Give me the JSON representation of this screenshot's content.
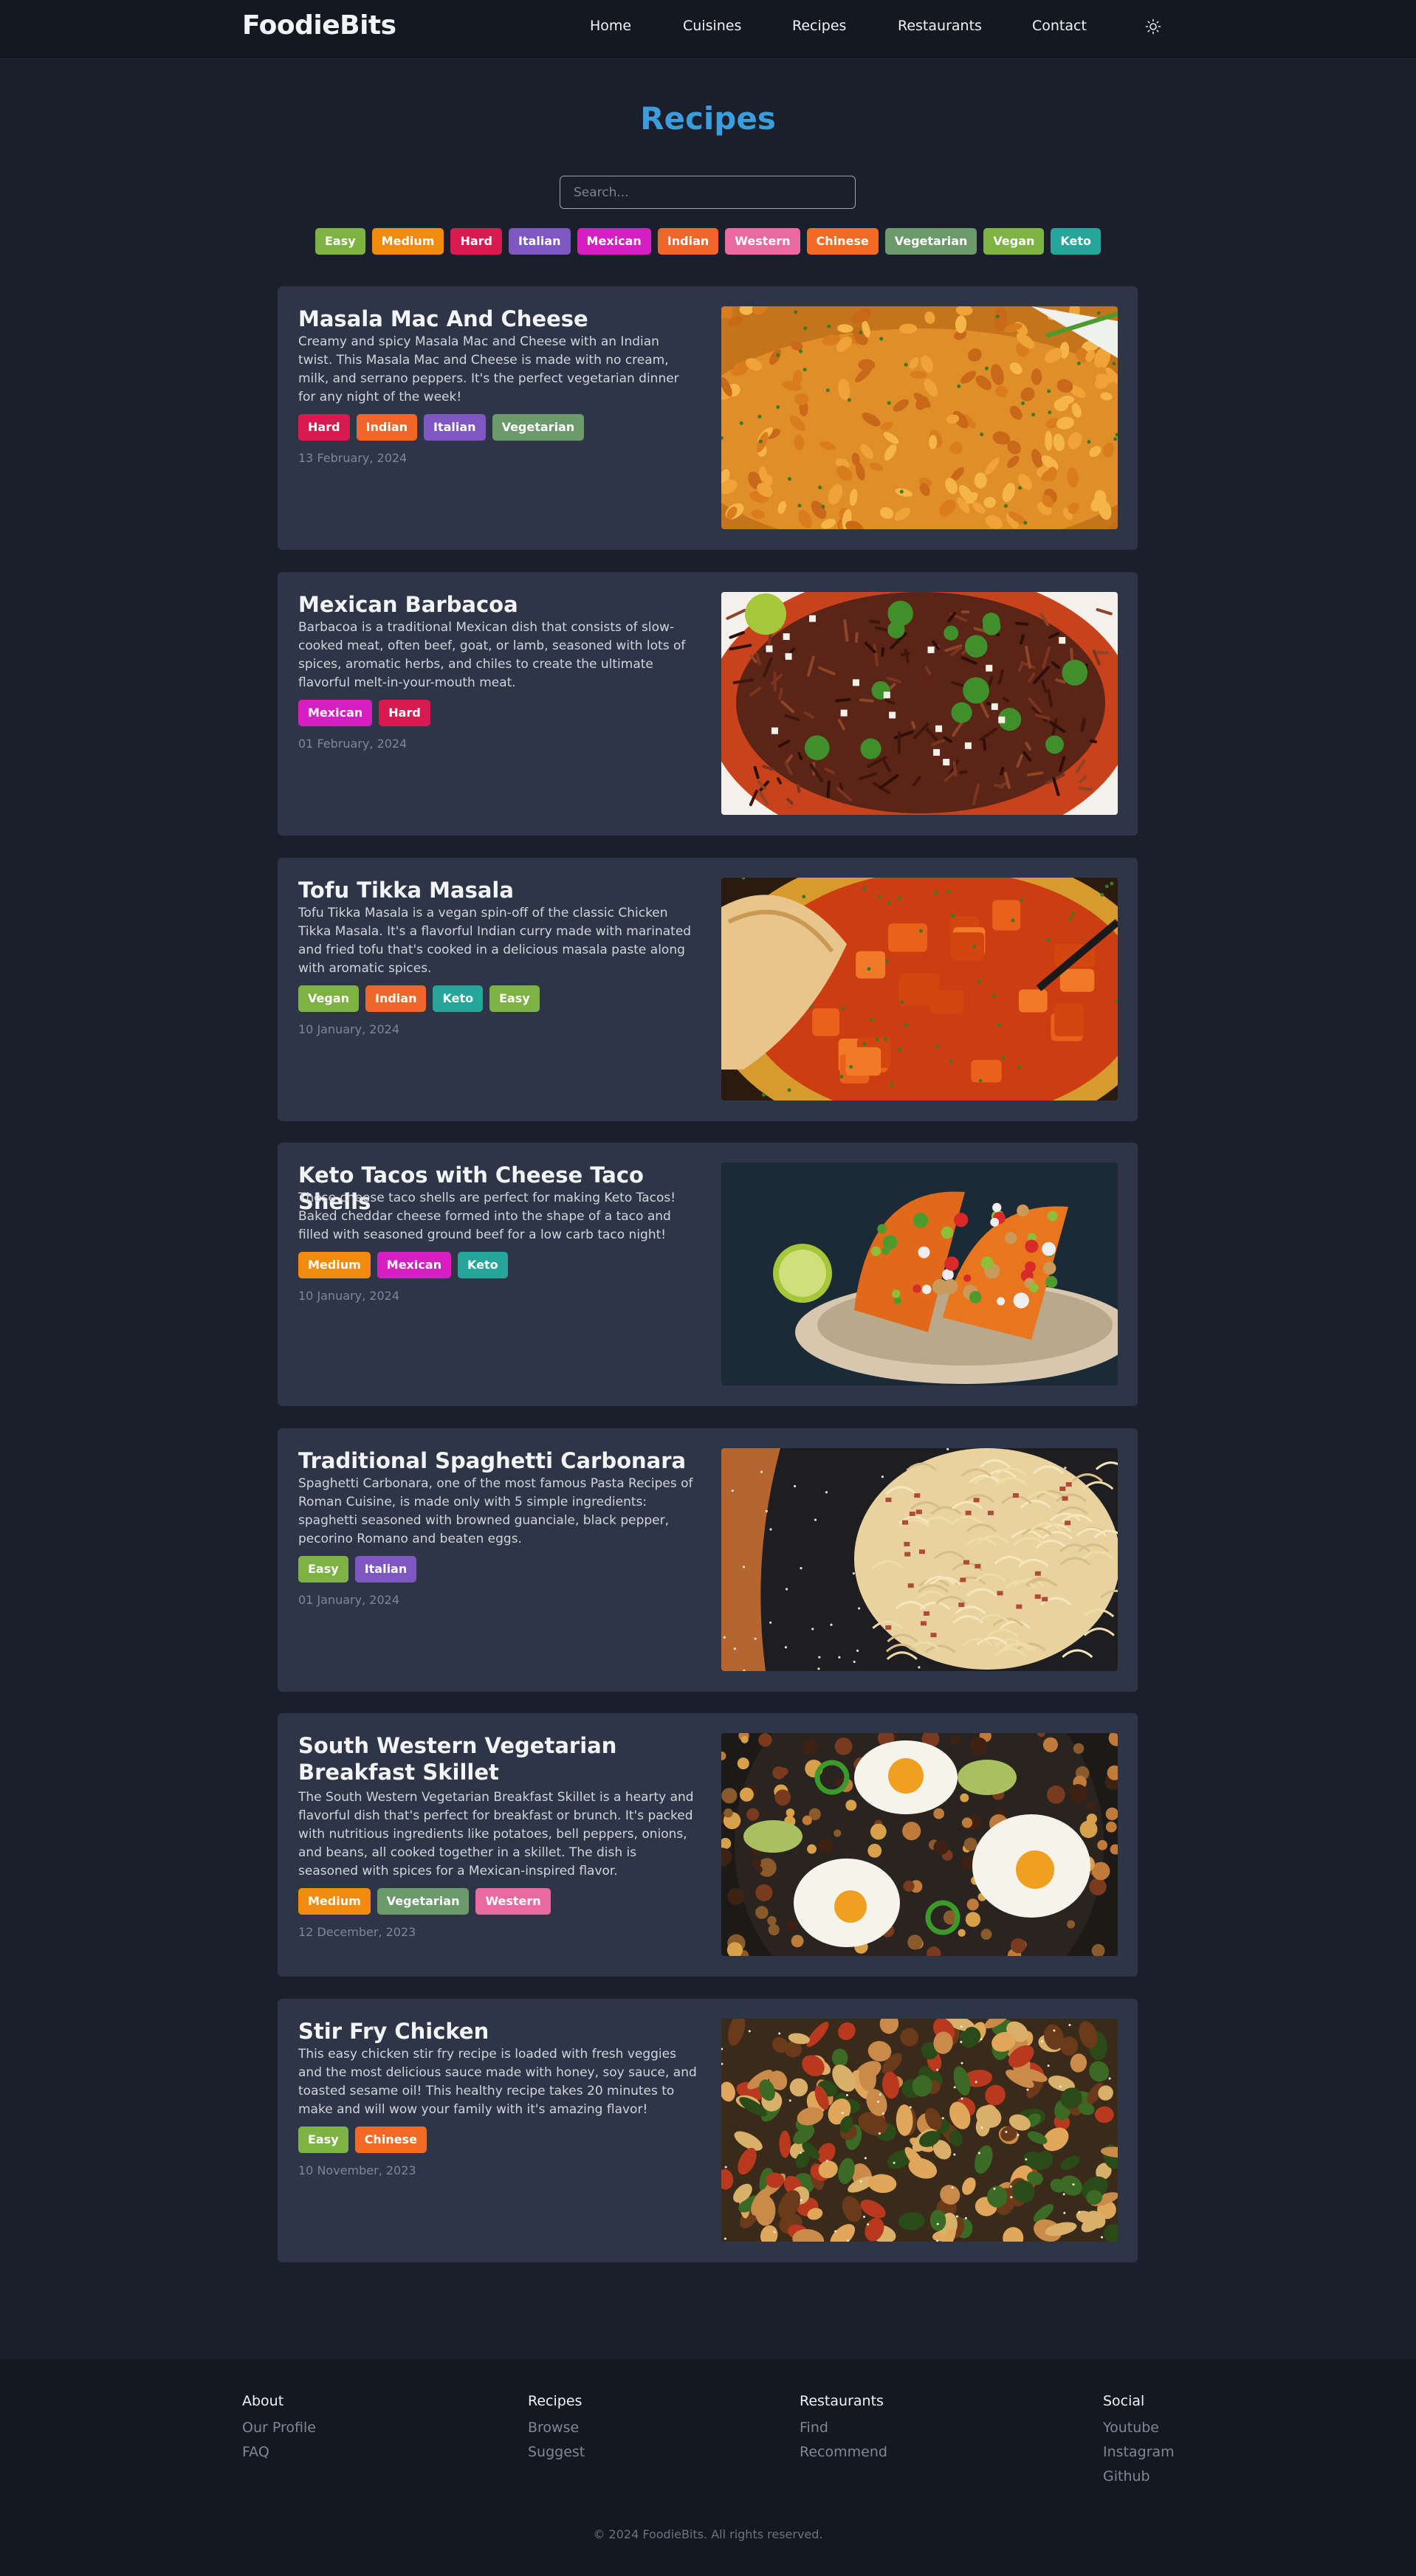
{
  "nav": {
    "brand": "FoodieBits",
    "links": [
      "Home",
      "Cuisines",
      "Recipes",
      "Restaurants",
      "Contact"
    ],
    "theme_icon": "sun-icon"
  },
  "page": {
    "title": "Recipes",
    "search_placeholder": "Search..."
  },
  "tag_colors": {
    "Easy": "#7cb342",
    "Medium": "#f28b0c",
    "Hard": "#d81b4f",
    "Italian": "#7e57c2",
    "Mexican": "#d61fc0",
    "Indian": "#f0652a",
    "Western": "#e86aa0",
    "Chinese": "#f26a26",
    "Vegetarian": "#6b9a6b",
    "Vegan": "#7cb342",
    "Keto": "#26a69a"
  },
  "filters": [
    "Easy",
    "Medium",
    "Hard",
    "Italian",
    "Mexican",
    "Indian",
    "Western",
    "Chinese",
    "Vegetarian",
    "Vegan",
    "Keto"
  ],
  "recipes": [
    {
      "title": "Masala Mac And Cheese",
      "description": "Creamy and spicy Masala Mac and Cheese with an Indian twist. This Masala Mac and Cheese is made with no cream, milk, and serrano peppers. It's the perfect vegetarian dinner for any night of the week!",
      "tags": [
        "Hard",
        "Indian",
        "Italian",
        "Vegetarian"
      ],
      "date": "13 February, 2024",
      "image": "masala-mac-and-cheese-photo"
    },
    {
      "title": "Mexican Barbacoa",
      "description": "Barbacoa is a traditional Mexican dish that consists of slow-cooked meat, often beef, goat, or lamb, seasoned with lots of spices, aromatic herbs, and chiles to create the ultimate flavorful melt-in-your-mouth meat.",
      "tags": [
        "Mexican",
        "Hard"
      ],
      "date": "01 February, 2024",
      "image": "mexican-barbacoa-photo"
    },
    {
      "title": "Tofu Tikka Masala",
      "description": "Tofu Tikka Masala is a vegan spin-off of the classic Chicken Tikka Masala. It's a flavorful Indian curry made with marinated and fried tofu that's cooked in a delicious masala paste along with aromatic spices.",
      "tags": [
        "Vegan",
        "Indian",
        "Keto",
        "Easy"
      ],
      "date": "10 January, 2024",
      "image": "tofu-tikka-masala-photo"
    },
    {
      "title": "Keto Tacos with Cheese Taco Shells",
      "description": "These cheese taco shells are perfect for making Keto Tacos! Baked cheddar cheese formed into the shape of a taco and filled with seasoned ground beef for a low carb taco night!",
      "tags": [
        "Medium",
        "Mexican",
        "Keto"
      ],
      "date": "10 January, 2024",
      "image": "keto-tacos-photo"
    },
    {
      "title": "Traditional Spaghetti Carbonara",
      "description": "Spaghetti Carbonara, one of the most famous Pasta Recipes of Roman Cuisine, is made only with 5 simple ingredients: spaghetti seasoned with browned guanciale, black pepper, pecorino Romano and beaten eggs.",
      "tags": [
        "Easy",
        "Italian"
      ],
      "date": "01 January, 2024",
      "image": "spaghetti-carbonara-photo"
    },
    {
      "title": "South Western Vegetarian Breakfast Skillet",
      "description": "The South Western Vegetarian Breakfast Skillet is a hearty and flavorful dish that's perfect for breakfast or brunch. It's packed with nutritious ingredients like potatoes, bell peppers, onions, and beans, all cooked together in a skillet. The dish is seasoned with spices for a Mexican-inspired flavor.",
      "tags": [
        "Medium",
        "Vegetarian",
        "Western"
      ],
      "date": "12 December, 2023",
      "image": "breakfast-skillet-photo"
    },
    {
      "title": "Stir Fry Chicken",
      "description": "This easy chicken stir fry recipe is loaded with fresh veggies and the most delicious sauce made with honey, soy sauce, and toasted sesame oil! This healthy recipe takes 20 minutes to make and will wow your family with it's amazing flavor!",
      "tags": [
        "Easy",
        "Chinese"
      ],
      "date": "10 November, 2023",
      "image": "stir-fry-chicken-photo"
    }
  ],
  "footer": {
    "columns": [
      {
        "heading": "About",
        "links": [
          "Our Profile",
          "FAQ"
        ]
      },
      {
        "heading": "Recipes",
        "links": [
          "Browse",
          "Suggest"
        ]
      },
      {
        "heading": "Restaurants",
        "links": [
          "Find",
          "Recommend"
        ]
      },
      {
        "heading": "Social",
        "links": [
          "Youtube",
          "Instagram",
          "Github"
        ]
      }
    ],
    "copyright": "© 2024 FoodieBits. All rights reserved."
  }
}
